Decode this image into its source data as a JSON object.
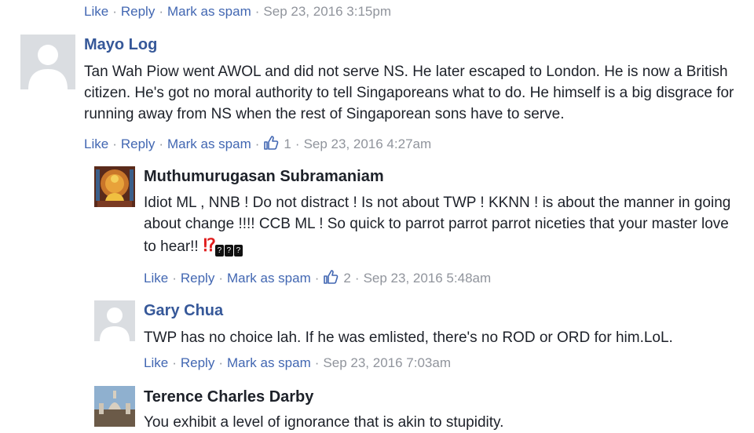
{
  "colors": {
    "link_blue": "#4267b2",
    "name_blue": "#365899",
    "meta_gray": "#90949c",
    "text_dark": "#1d2129"
  },
  "top_actions": {
    "like": "Like",
    "reply": "Reply",
    "spam": "Mark as spam",
    "timestamp": "Sep 23, 2016 3:15pm"
  },
  "comments": [
    {
      "author": "Mayo Log",
      "text": "Tan Wah Piow went AWOL and did not serve NS. He later escaped to London. He is now a British citizen. He's got no moral authority to tell Singaporeans what to do. He himself is a big disgrace for running away from NS when the rest of Singaporean sons have to serve.",
      "actions": {
        "like": "Like",
        "reply": "Reply",
        "spam": "Mark as spam",
        "like_count": "1",
        "timestamp": "Sep 23, 2016 4:27am"
      }
    },
    {
      "author": "Muthumurugasan Subramaniam",
      "text": "Idiot ML , NNB ! Do not distract ! Is not about TWP ! KKNN ! is about the manner in going about change !!!! CCB ML ! So quick to parrot parrot parrot niceties that your master love to hear!!",
      "emoji": "⁉",
      "actions": {
        "like": "Like",
        "reply": "Reply",
        "spam": "Mark as spam",
        "like_count": "2",
        "timestamp": "Sep 23, 2016 5:48am"
      }
    },
    {
      "author": "Gary Chua",
      "text": "TWP has no choice lah. If he was emlisted, there's no ROD or ORD for him.LoL.",
      "actions": {
        "like": "Like",
        "reply": "Reply",
        "spam": "Mark as spam",
        "timestamp": "Sep 23, 2016 7:03am"
      }
    },
    {
      "author": "Terence Charles Darby",
      "text": "You exhibit a level of ignorance that is akin to stupidity."
    }
  ],
  "icons": {
    "generic_avatar": "default-avatar-silhouette",
    "like": "thumbs-up-icon"
  }
}
